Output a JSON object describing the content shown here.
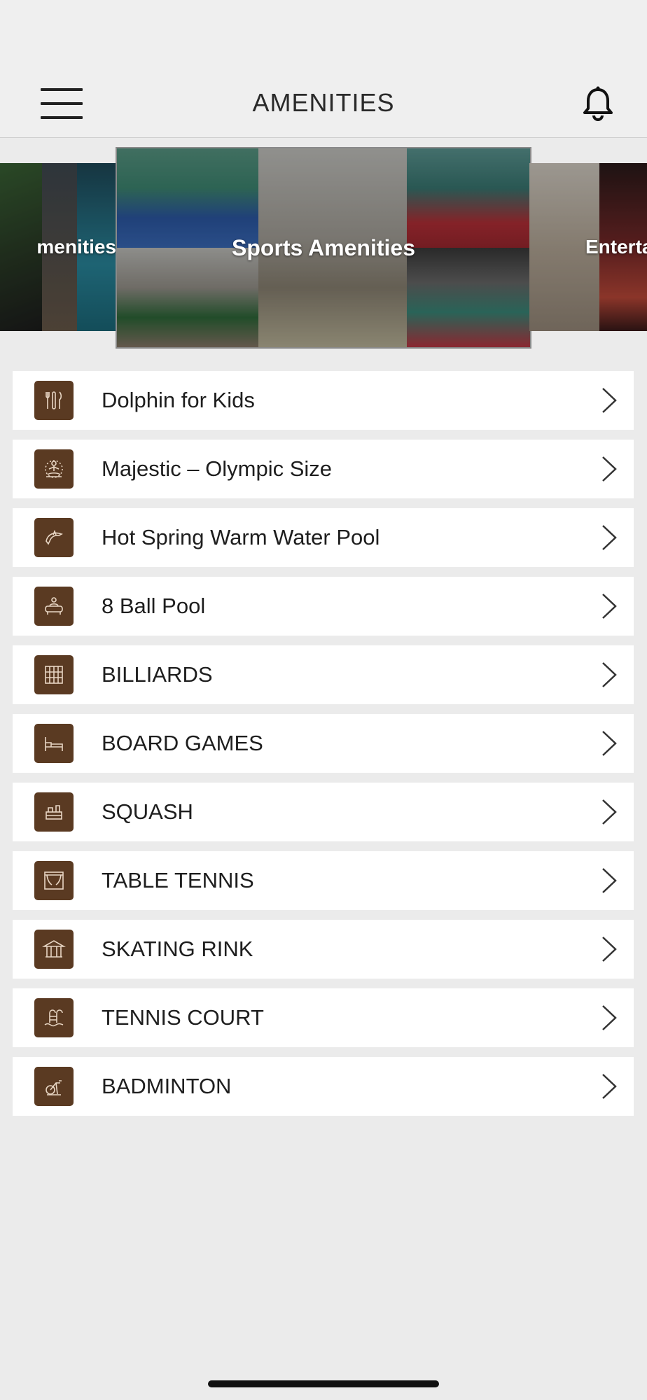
{
  "header": {
    "title": "AMENITIES"
  },
  "carousel": {
    "left_label": "menities",
    "center_label": "Sports Amenities",
    "right_label": "Enterta"
  },
  "items": [
    {
      "label": "Dolphin for Kids",
      "icon": "cutlery-icon"
    },
    {
      "label": "Majestic – Olympic Size",
      "icon": "meditation-icon"
    },
    {
      "label": "Hot Spring Warm Water Pool",
      "icon": "dolphin-icon"
    },
    {
      "label": "8 Ball Pool",
      "icon": "spa-icon"
    },
    {
      "label": "BILLIARDS",
      "icon": "library-icon"
    },
    {
      "label": "BOARD GAMES",
      "icon": "bed-icon"
    },
    {
      "label": "SQUASH",
      "icon": "kids-play-icon"
    },
    {
      "label": "TABLE TENNIS",
      "icon": "theatre-icon"
    },
    {
      "label": "SKATING RINK",
      "icon": "gazebo-icon"
    },
    {
      "label": "TENNIS COURT",
      "icon": "pool-ladder-icon"
    },
    {
      "label": "BADMINTON",
      "icon": "exercise-bike-icon"
    }
  ],
  "colors": {
    "icon_bg": "#5a3a22",
    "background": "#ebebeb",
    "header_bg": "#efefef"
  }
}
